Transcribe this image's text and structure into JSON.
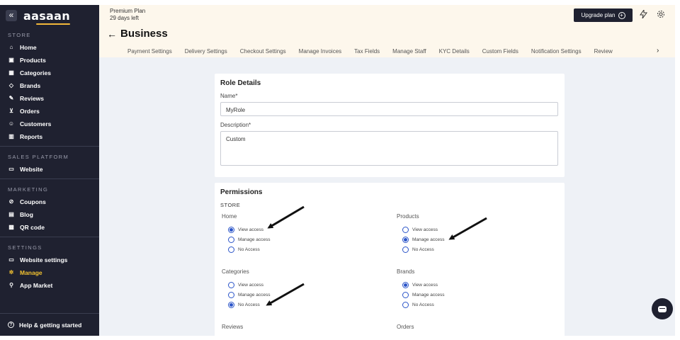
{
  "sidebar": {
    "collapse_icon": "«",
    "logo": "aasaan",
    "sections": {
      "store": "STORE",
      "sales": "SALES PLATFORM",
      "marketing": "MARKETING",
      "settings": "SETTINGS"
    },
    "items": {
      "home": "Home",
      "products": "Products",
      "categories": "Categories",
      "brands": "Brands",
      "reviews": "Reviews",
      "orders": "Orders",
      "customers": "Customers",
      "reports": "Reports",
      "website": "Website",
      "coupons": "Coupons",
      "blog": "Blog",
      "qr_code": "QR code",
      "website_settings": "Website settings",
      "manage": "Manage",
      "app_market": "App Market"
    },
    "help": "Help & getting started",
    "active_color": "#f2c230"
  },
  "header": {
    "plan_name": "Premium Plan",
    "plan_days": "29 days left",
    "back_icon": "←",
    "title": "Business",
    "upgrade_label": "Upgrade plan",
    "tabs": [
      "Payment Settings",
      "Delivery Settings",
      "Checkout Settings",
      "Manage Invoices",
      "Tax Fields",
      "Manage Staff",
      "KYC Details",
      "Custom Fields",
      "Notification Settings",
      "Review"
    ],
    "more_icon": "›"
  },
  "role_details": {
    "title": "Role Details",
    "name_label": "Name*",
    "name_value": "MyRole",
    "description_label": "Description*",
    "description_value": "Custom"
  },
  "permissions": {
    "title": "Permissions",
    "store_label": "STORE",
    "groups": {
      "home": {
        "title": "Home",
        "selected": "View access"
      },
      "products": {
        "title": "Products",
        "selected": "Manage access"
      },
      "categories": {
        "title": "Categories",
        "selected": "No Access"
      },
      "brands": {
        "title": "Brands",
        "selected": "View access"
      },
      "reviews": {
        "title": "Reviews"
      },
      "orders": {
        "title": "Orders"
      }
    },
    "options": {
      "view": "View access",
      "manage": "Manage access",
      "none": "No Access"
    }
  },
  "colors": {
    "sidebar_bg": "#1f2130",
    "header_bg": "#fdf7ec",
    "main_bg": "#eef1f6",
    "radio_accent": "#2b55c9"
  }
}
